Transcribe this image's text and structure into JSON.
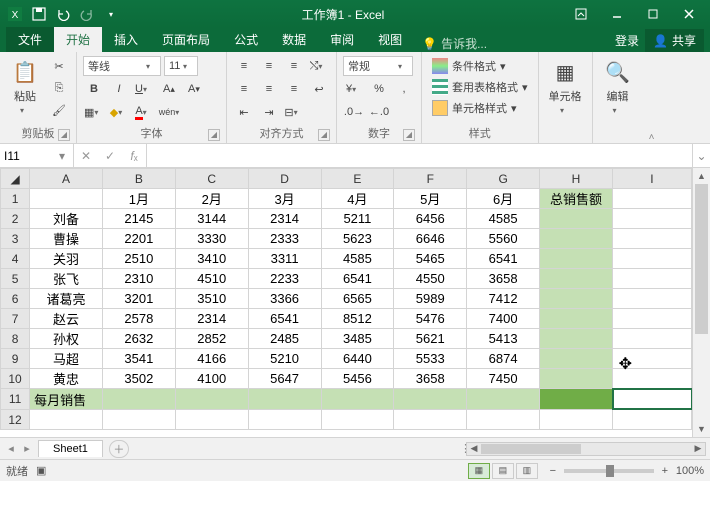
{
  "titlebar": {
    "title": "工作簿1 - Excel"
  },
  "tabs": {
    "file": "文件",
    "home": "开始",
    "insert": "插入",
    "layout": "页面布局",
    "formulas": "公式",
    "data": "数据",
    "review": "审阅",
    "view": "视图",
    "tellme": "告诉我...",
    "login": "登录",
    "share": "共享"
  },
  "ribbon": {
    "clipboard": {
      "label": "剪贴板",
      "paste": "粘贴"
    },
    "font": {
      "label": "字体",
      "name": "等线",
      "size": "11"
    },
    "align": {
      "label": "对齐方式"
    },
    "number": {
      "label": "数字",
      "format": "常规"
    },
    "styles": {
      "label": "样式",
      "cond": "条件格式",
      "table": "套用表格格式",
      "cell": "单元格样式"
    },
    "cells": {
      "label": "单元格"
    },
    "editing": {
      "label": "编辑"
    }
  },
  "fx": {
    "name": "I11"
  },
  "grid": {
    "cols": [
      "A",
      "B",
      "C",
      "D",
      "E",
      "F",
      "G",
      "H",
      "I"
    ],
    "headers": [
      "",
      "1月",
      "2月",
      "3月",
      "4月",
      "5月",
      "6月",
      "总销售额"
    ],
    "rows": [
      {
        "n": "刘备",
        "v": [
          2145,
          3144,
          2314,
          5211,
          6456,
          4585
        ]
      },
      {
        "n": "曹操",
        "v": [
          2201,
          3330,
          2333,
          5623,
          6646,
          5560
        ]
      },
      {
        "n": "关羽",
        "v": [
          2510,
          3410,
          3311,
          4585,
          5465,
          6541
        ]
      },
      {
        "n": "张飞",
        "v": [
          2310,
          4510,
          2233,
          6541,
          4550,
          3658
        ]
      },
      {
        "n": "诸葛亮",
        "v": [
          3201,
          3510,
          3366,
          6565,
          5989,
          7412
        ]
      },
      {
        "n": "赵云",
        "v": [
          2578,
          2314,
          6541,
          8512,
          5476,
          7400
        ]
      },
      {
        "n": "孙权",
        "v": [
          2632,
          2852,
          2485,
          3485,
          5621,
          5413
        ]
      },
      {
        "n": "马超",
        "v": [
          3541,
          4166,
          5210,
          6440,
          5533,
          6874
        ]
      },
      {
        "n": "黄忠",
        "v": [
          3502,
          4100,
          5647,
          5456,
          3658,
          7450
        ]
      }
    ],
    "footer": "每月销售"
  },
  "sheets": {
    "s1": "Sheet1"
  },
  "status": {
    "ready": "就绪",
    "zoom": "100%"
  },
  "chart_data": {
    "type": "table",
    "title": "月销售数据",
    "categories": [
      "1月",
      "2月",
      "3月",
      "4月",
      "5月",
      "6月"
    ],
    "series": [
      {
        "name": "刘备",
        "values": [
          2145,
          3144,
          2314,
          5211,
          6456,
          4585
        ]
      },
      {
        "name": "曹操",
        "values": [
          2201,
          3330,
          2333,
          5623,
          6646,
          5560
        ]
      },
      {
        "name": "关羽",
        "values": [
          2510,
          3410,
          3311,
          4585,
          5465,
          6541
        ]
      },
      {
        "name": "张飞",
        "values": [
          2310,
          4510,
          2233,
          6541,
          4550,
          3658
        ]
      },
      {
        "name": "诸葛亮",
        "values": [
          3201,
          3510,
          3366,
          6565,
          5989,
          7412
        ]
      },
      {
        "name": "赵云",
        "values": [
          2578,
          2314,
          6541,
          8512,
          5476,
          7400
        ]
      },
      {
        "name": "孙权",
        "values": [
          2632,
          2852,
          2485,
          3485,
          5621,
          5413
        ]
      },
      {
        "name": "马超",
        "values": [
          3541,
          4166,
          5210,
          6440,
          5533,
          6874
        ]
      },
      {
        "name": "黄忠",
        "values": [
          3502,
          4100,
          5647,
          5456,
          3658,
          7450
        ]
      }
    ]
  }
}
